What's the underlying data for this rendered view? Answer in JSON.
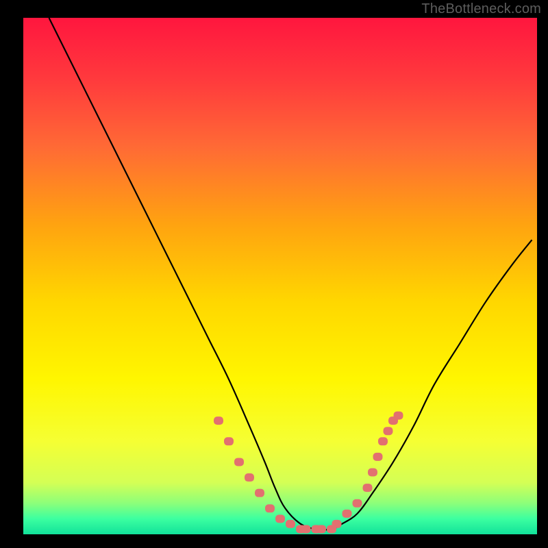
{
  "watermark": "TheBottleneck.com",
  "colors": {
    "frame": "#000000",
    "curve": "#000000",
    "dot": "#e27070",
    "gradient_stops": [
      {
        "offset": 0.0,
        "color": "#ff163e"
      },
      {
        "offset": 0.12,
        "color": "#ff3a3d"
      },
      {
        "offset": 0.25,
        "color": "#ff6a35"
      },
      {
        "offset": 0.4,
        "color": "#ffa310"
      },
      {
        "offset": 0.55,
        "color": "#ffd700"
      },
      {
        "offset": 0.7,
        "color": "#fff600"
      },
      {
        "offset": 0.82,
        "color": "#f5ff33"
      },
      {
        "offset": 0.9,
        "color": "#d4ff55"
      },
      {
        "offset": 0.94,
        "color": "#8cff7a"
      },
      {
        "offset": 0.97,
        "color": "#3cffa0"
      },
      {
        "offset": 1.0,
        "color": "#11e29a"
      }
    ]
  },
  "chart_data": {
    "type": "line",
    "title": "",
    "xlabel": "",
    "ylabel": "",
    "xlim": [
      0,
      100
    ],
    "ylim": [
      0,
      100
    ],
    "series": [
      {
        "name": "curve",
        "x": [
          5,
          8,
          12,
          16,
          20,
          24,
          28,
          32,
          36,
          40,
          44,
          47,
          49,
          51,
          54,
          57,
          60,
          62,
          65,
          68,
          72,
          76,
          80,
          85,
          90,
          95,
          99
        ],
        "y": [
          100,
          94,
          86,
          78,
          70,
          62,
          54,
          46,
          38,
          30,
          21,
          14,
          9,
          5,
          2,
          1,
          1,
          2,
          4,
          8,
          14,
          21,
          29,
          37,
          45,
          52,
          57
        ]
      }
    ],
    "highlight_points": {
      "name": "dots",
      "x": [
        38,
        40,
        42,
        44,
        46,
        48,
        50,
        52,
        54,
        55,
        57,
        58,
        60,
        61,
        63,
        65,
        67,
        68,
        69,
        70,
        71,
        72,
        73
      ],
      "y": [
        22,
        18,
        14,
        11,
        8,
        5,
        3,
        2,
        1,
        1,
        1,
        1,
        1,
        2,
        4,
        6,
        9,
        12,
        15,
        18,
        20,
        22,
        23
      ]
    }
  }
}
